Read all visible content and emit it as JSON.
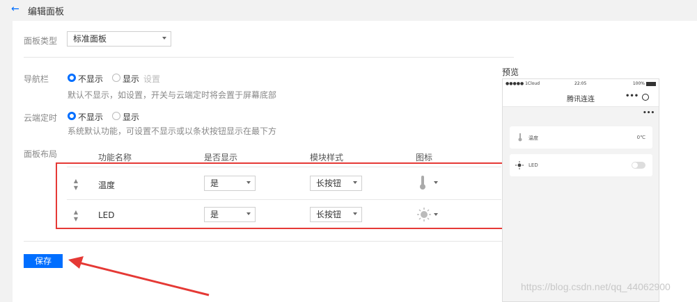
{
  "header": {
    "back_icon": "←",
    "title": "编辑面板"
  },
  "panel_type": {
    "label": "面板类型",
    "value": "标准面板"
  },
  "nav_bar": {
    "label": "导航栏",
    "option_hide": "不显示",
    "option_show": "显示",
    "settings_link": "设置",
    "desc": "默认不显示，如设置，开关与云端定时将会置于屏幕底部"
  },
  "cloud_timer": {
    "label": "云端定时",
    "option_hide": "不显示",
    "option_show": "显示",
    "desc": "系统默认功能，可设置不显示或以条状按钮显示在最下方"
  },
  "layout": {
    "label": "面板布局",
    "headers": {
      "name": "功能名称",
      "visible": "是否显示",
      "style": "模块样式",
      "icon": "图标"
    },
    "rows": [
      {
        "name": "温度",
        "visible": "是",
        "style": "长按钮",
        "icon": "thermometer-icon"
      },
      {
        "name": "LED",
        "visible": "是",
        "style": "长按钮",
        "icon": "sun-icon"
      }
    ]
  },
  "save_label": "保存",
  "preview": {
    "label": "预览",
    "carrier": "●●●●● 1Cloud",
    "time": "22:05",
    "battery": "100%",
    "title": "腾讯连连",
    "more": "•••",
    "card_temp_label": "温度",
    "card_temp_value": "0℃",
    "card_led_label": "LED"
  },
  "watermark": "https://blog.csdn.net/qq_44062900",
  "colors": {
    "accent": "#006eff",
    "highlight": "#e53935"
  }
}
